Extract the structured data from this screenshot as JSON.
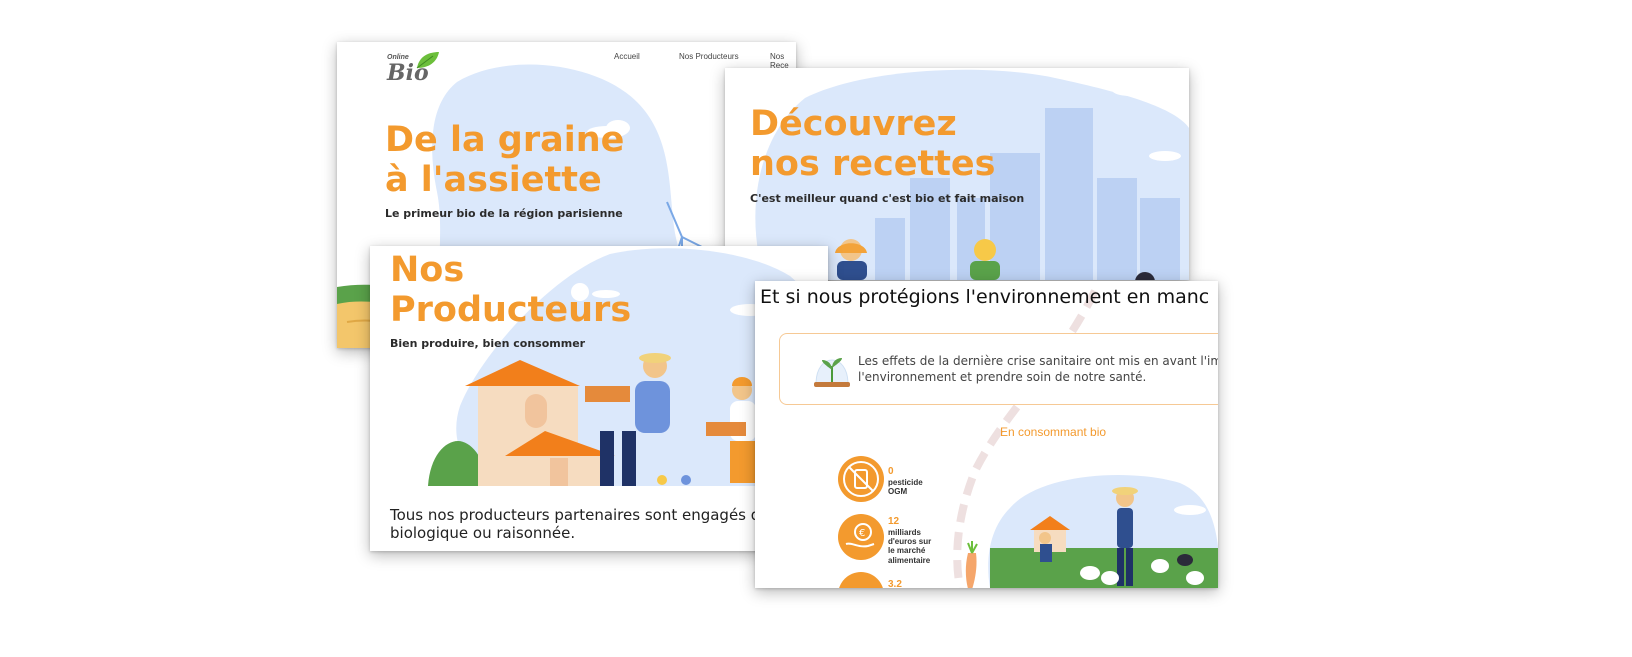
{
  "card1": {
    "logo_small": "Online",
    "logo_big": "Bio",
    "nav": [
      "Accueil",
      "Nos Producteurs",
      "Nos Rece"
    ],
    "title_line1": "De la graine",
    "title_line2": "à l'assiette",
    "subtitle": "Le primeur bio de la région parisienne"
  },
  "card2": {
    "title_line1": "Découvrez",
    "title_line2": "nos recettes",
    "subtitle": "C'est meilleur quand c'est bio et fait maison"
  },
  "card3": {
    "title_line1": "Nos",
    "title_line2": "Producteurs",
    "subtitle": "Bien produire, bien consommer",
    "body_line1": "Tous nos producteurs partenaires sont engagés da",
    "body_line2": "biologique ou raisonnée."
  },
  "card4": {
    "heading": "Et si nous protégions l'environnement en manc",
    "info_line1": "Les effets de la dernière crise sanitaire ont mis en avant l'import",
    "info_line2": "l'environnement et prendre soin de notre santé.",
    "section_label": "En consommant bio",
    "stats": [
      {
        "number": "0",
        "text_lines": [
          "pesticide",
          "OGM"
        ]
      },
      {
        "number": "12",
        "text_lines": [
          "milliards",
          "d'euros sur",
          "le marché",
          "alimentaire"
        ]
      },
      {
        "number": "3.2",
        "text_lines": []
      }
    ]
  },
  "colors": {
    "accent": "#f39a2e",
    "sky": "#dbe8fb",
    "grass": "#5aa24a"
  }
}
